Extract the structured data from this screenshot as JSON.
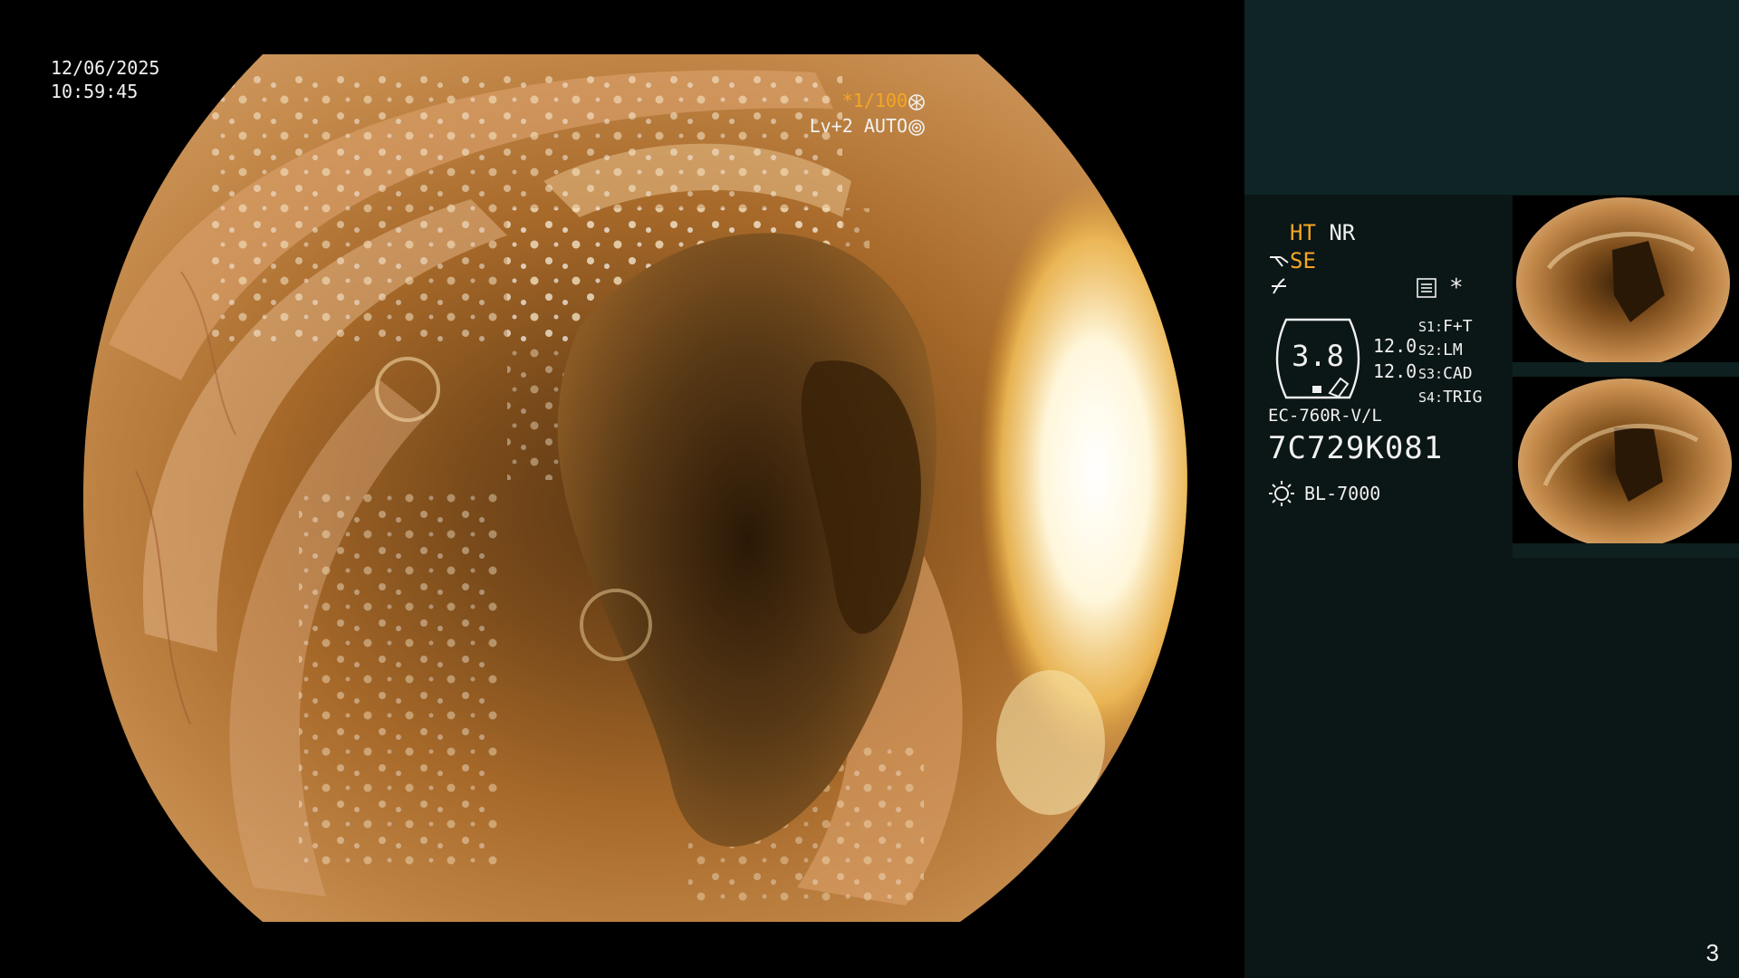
{
  "overlay": {
    "date": "12/06/2025",
    "time": "10:59:45",
    "shutter": "*1/100",
    "exposure": "Lv+2 AUTO"
  },
  "panel": {
    "ht": "HT",
    "nr": "NR",
    "se": "SE",
    "gauge_value": "3.8",
    "gauge_upper": "12.0",
    "gauge_lower": "12.0",
    "star": "*",
    "switches": [
      {
        "key": "S1:",
        "value": "F+T"
      },
      {
        "key": "S2:",
        "value": "LM"
      },
      {
        "key": "S3:",
        "value": "CAD"
      },
      {
        "key": "S4:",
        "value": "TRIG"
      }
    ],
    "scope_model": "EC-760R-V/L",
    "scope_serial": "7C729K081",
    "light_source": "BL-7000"
  },
  "page_number": "3",
  "colors": {
    "accent": "#f5a623",
    "panel_bg": "#0b1616",
    "panel_top_bg": "#0f2525",
    "mucosa": "#b8752c"
  },
  "icons": [
    "shutter-mode-icon",
    "exposure-mode-icon",
    "scope-switch-icon",
    "freeze-icon",
    "menu-icon",
    "light-source-icon"
  ]
}
